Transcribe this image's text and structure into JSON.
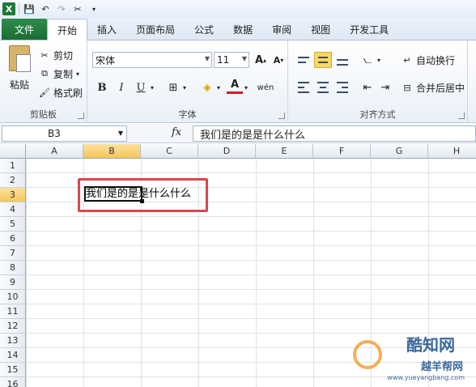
{
  "qat": {
    "icons": [
      "excel-icon",
      "save-icon",
      "undo-icon",
      "redo-icon",
      "customize-icon"
    ]
  },
  "tabs": [
    {
      "label": "文件"
    },
    {
      "label": "开始"
    },
    {
      "label": "插入"
    },
    {
      "label": "页面布局"
    },
    {
      "label": "公式"
    },
    {
      "label": "数据"
    },
    {
      "label": "审阅"
    },
    {
      "label": "视图"
    },
    {
      "label": "开发工具"
    }
  ],
  "clipboard": {
    "paste": "粘贴",
    "cut": "剪切",
    "copy": "复制",
    "format_painter": "格式刷",
    "label": "剪贴板"
  },
  "font": {
    "name": "宋体",
    "size": "11",
    "label": "字体",
    "bold": "B",
    "italic": "I",
    "underline": "U",
    "increase": "A",
    "decrease": "A"
  },
  "alignment": {
    "wrap_text": "自动换行",
    "merge_center": "合并后居中",
    "label": "对齐方式"
  },
  "formula_bar": {
    "name_box": "B3",
    "fx": "fx",
    "content": "我们是的是是什么什么"
  },
  "grid": {
    "columns": [
      "A",
      "B",
      "C",
      "D",
      "E",
      "F",
      "G",
      "H"
    ],
    "rows": [
      "1",
      "2",
      "3",
      "4",
      "5",
      "6",
      "7",
      "8",
      "9",
      "10",
      "11",
      "12",
      "13",
      "14",
      "15",
      "16"
    ],
    "selected_col": "B",
    "selected_row": "3",
    "cell_b3": "我们是的是是什么什么"
  },
  "watermark": {
    "title": "酷知网",
    "sub": "越羊帮网",
    "url": "www.yueyangbang.com"
  },
  "colors": {
    "file_tab": "#1f7a3a",
    "highlight_box": "#d9474e",
    "selected_header": "#f5c65b"
  }
}
